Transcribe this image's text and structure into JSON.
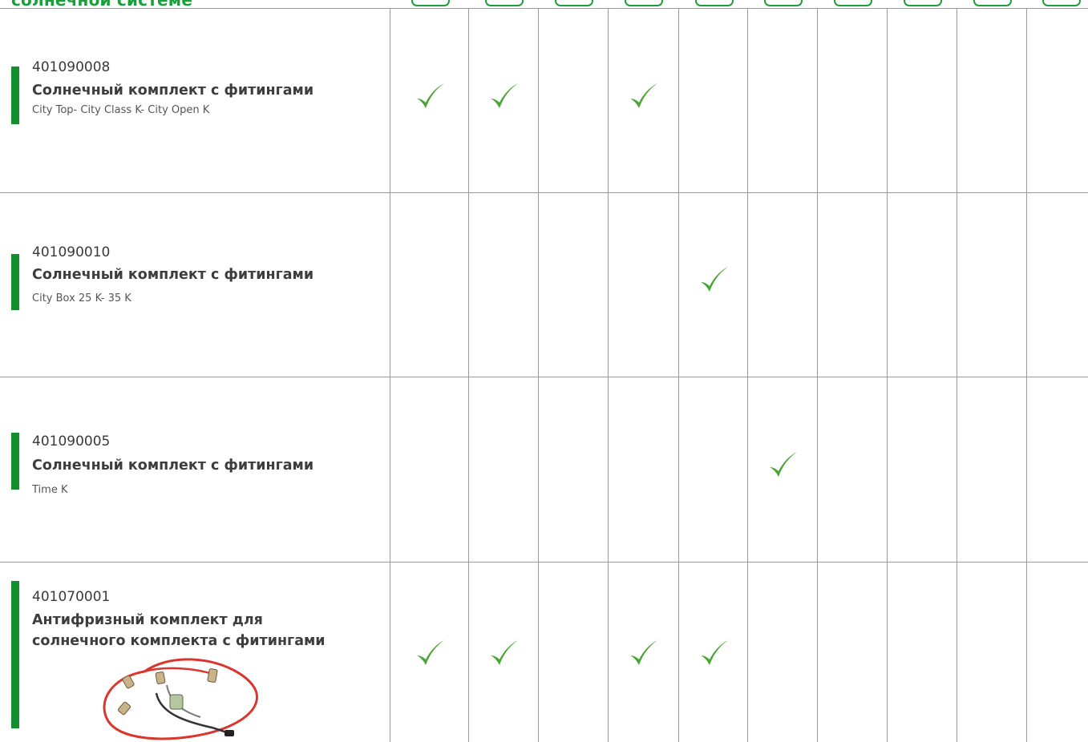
{
  "header": {
    "title": "солнечной системе",
    "column_tab_count": 10
  },
  "colors": {
    "accent_green": "#12902f",
    "check_green": "#4aa534",
    "title_green": "#19a03a",
    "grid_line": "#9a9a9a"
  },
  "icons": {
    "check": "check-icon",
    "product": "antifreeze-kit-cable-image"
  },
  "rows": [
    {
      "code": "401090008",
      "name": "Солнечный комплект с фитингами",
      "models": "City Top- City Class K- City Open K",
      "checks": [
        true,
        true,
        false,
        true,
        false,
        false,
        false,
        false,
        false,
        false
      ]
    },
    {
      "code": "401090010",
      "name": "Солнечный комплект с фитингами",
      "models": "City Box 25 K- 35 K",
      "checks": [
        false,
        false,
        false,
        false,
        true,
        false,
        false,
        false,
        false,
        false
      ]
    },
    {
      "code": "401090005",
      "name": "Солнечный комплект с фитингами",
      "models": "Time K",
      "checks": [
        false,
        false,
        false,
        false,
        false,
        true,
        false,
        false,
        false,
        false
      ]
    },
    {
      "code": "401070001",
      "name": "Антифризный комплект для солнечного комплекта с фитингами",
      "models": "",
      "checks": [
        true,
        true,
        false,
        true,
        true,
        false,
        false,
        false,
        false,
        false
      ]
    }
  ]
}
